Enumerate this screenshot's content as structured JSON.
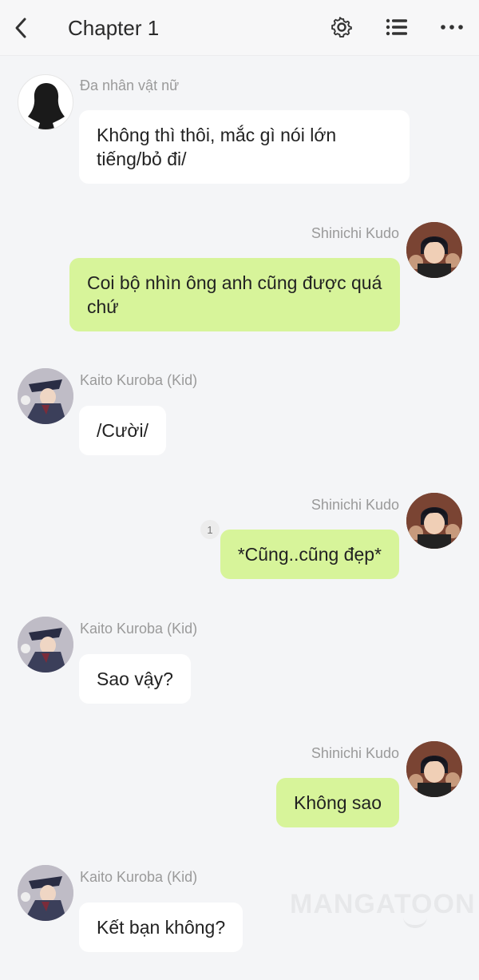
{
  "header": {
    "title": "Chapter 1",
    "icons": [
      "back-icon",
      "gear-icon",
      "list-icon",
      "more-icon"
    ]
  },
  "messages": [
    {
      "side": "left",
      "sender": "Đa nhân vật nữ",
      "text": "Không thì thôi, mắc gì nói lớn tiếng/bỏ đi/"
    },
    {
      "side": "right",
      "sender": "Shinichi Kudo",
      "text": "Coi bộ nhìn ông anh cũng được quá chứ"
    },
    {
      "side": "left",
      "sender": "Kaito Kuroba (Kid)",
      "text": "/Cười/"
    },
    {
      "side": "right",
      "sender": "Shinichi Kudo",
      "text": "*Cũng..cũng đẹp*",
      "badge": "1"
    },
    {
      "side": "left",
      "sender": "Kaito Kuroba (Kid)",
      "text": "Sao vậy?"
    },
    {
      "side": "right",
      "sender": "Shinichi Kudo",
      "text": "Không sao"
    },
    {
      "side": "left",
      "sender": "Kaito Kuroba (Kid)",
      "text": "Kết bạn không?"
    }
  ],
  "watermark": "MANGATOON",
  "colors": {
    "background": "#f4f5f7",
    "bubble_left": "#ffffff",
    "bubble_right": "#d7f49a",
    "name_text": "#9a9a9a"
  }
}
